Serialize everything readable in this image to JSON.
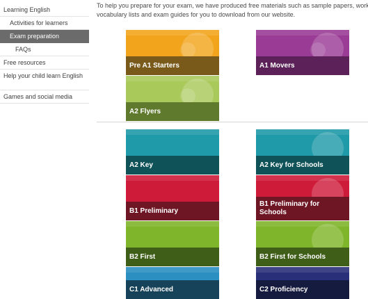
{
  "sidebar": {
    "items": [
      {
        "label": "Learning English",
        "level": 0,
        "active": false
      },
      {
        "label": "Activities for learners",
        "level": 1,
        "active": false
      },
      {
        "label": "Exam preparation",
        "level": 1,
        "active": true
      },
      {
        "label": "FAQs",
        "level": 2,
        "active": false
      },
      {
        "label": "Free resources",
        "level": 0,
        "active": false
      },
      {
        "label": "Help your child learn English",
        "level": 0,
        "active": false
      },
      {
        "label": "Games and social media",
        "level": 0,
        "active": false
      }
    ]
  },
  "intro": {
    "line1": "To help you prepare for your exam, we have produced free materials such as sample papers, worksheets,",
    "line2": "vocabulary lists and exam guides for you to download from our website."
  },
  "cards": [
    {
      "label": "Pre A1 Starters",
      "top_color": "#f2a51c",
      "band_color": "#7a5a1a"
    },
    {
      "label": "A1 Movers",
      "top_color": "#9a3b95",
      "band_color": "#5b2158"
    },
    {
      "label": "A2 Flyers",
      "top_color": "#a9c95a",
      "band_color": "#5f7a2d"
    },
    {
      "label": "A2 Key",
      "top_color": "#1f9aa8",
      "band_color": "#0f5358"
    },
    {
      "label": "A2 Key for Schools",
      "top_color": "#1f9aa8",
      "band_color": "#0f5358"
    },
    {
      "label": "B1 Preliminary",
      "top_color": "#cf1b3a",
      "band_color": "#6e1624"
    },
    {
      "label": "B1 Preliminary for Schools",
      "top_color": "#cf1b3a",
      "band_color": "#6e1624"
    },
    {
      "label": "B2 First",
      "top_color": "#7fb52a",
      "band_color": "#3f5e18"
    },
    {
      "label": "B2 First for Schools",
      "top_color": "#7fb52a",
      "band_color": "#3f5e18"
    },
    {
      "label": "C1 Advanced",
      "top_color": "#2b8fc2",
      "band_color": "#17435a"
    },
    {
      "label": "C2 Proficiency",
      "top_color": "#2a2f7a",
      "band_color": "#151a3f"
    }
  ]
}
